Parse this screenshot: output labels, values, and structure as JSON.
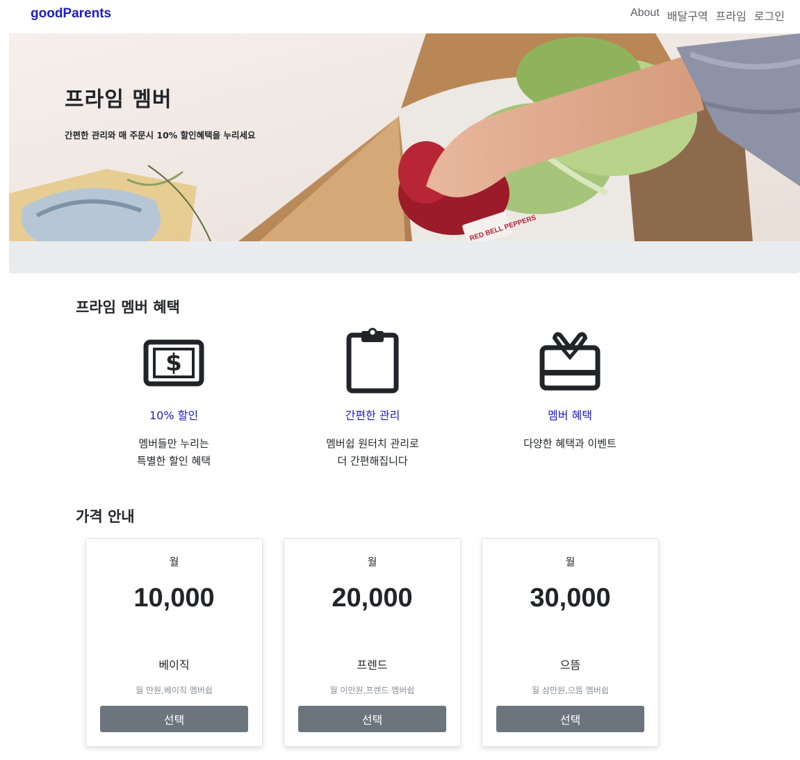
{
  "navbar": {
    "brand": "goodParents",
    "links": [
      "About",
      "배달구역",
      "프라임",
      "로그인"
    ]
  },
  "hero": {
    "title": "프라임 멤버",
    "subtitle": "간편한 관리와 매 주문시 10% 할인혜택을 누리세요",
    "image_label": "RED BELL PEPPERS"
  },
  "benefits": {
    "section_title": "프라임 멤버 혜택",
    "items": [
      {
        "icon": "dollar-card-icon",
        "title": "10% 할인",
        "desc": "멤버들만 누리는\n특별한 할인 혜택"
      },
      {
        "icon": "clipboard-icon",
        "title": "간편한 관리",
        "desc": "멤버쉽 원터치 관리로\n더 간편해집니다"
      },
      {
        "icon": "gift-card-icon",
        "title": "멤버 혜택",
        "desc": "다양한 혜택과 이벤트"
      }
    ]
  },
  "pricing": {
    "section_title": "가격 안내",
    "plans": [
      {
        "period": "월",
        "price": "10,000",
        "name": "베이직",
        "note": "월 만원,베이직 멤버쉽",
        "button": "선택"
      },
      {
        "period": "월",
        "price": "20,000",
        "name": "프렌드",
        "note": "월 이만원,프렌드 멤버쉽",
        "button": "선택"
      },
      {
        "period": "월",
        "price": "30,000",
        "name": "으뜸",
        "note": "월 삼만원,으뜸 멤버쉽",
        "button": "선택"
      }
    ]
  },
  "colors": {
    "brand": "#1a1ac9",
    "button": "#6c757d",
    "hero_bg": "#e9ecef"
  }
}
